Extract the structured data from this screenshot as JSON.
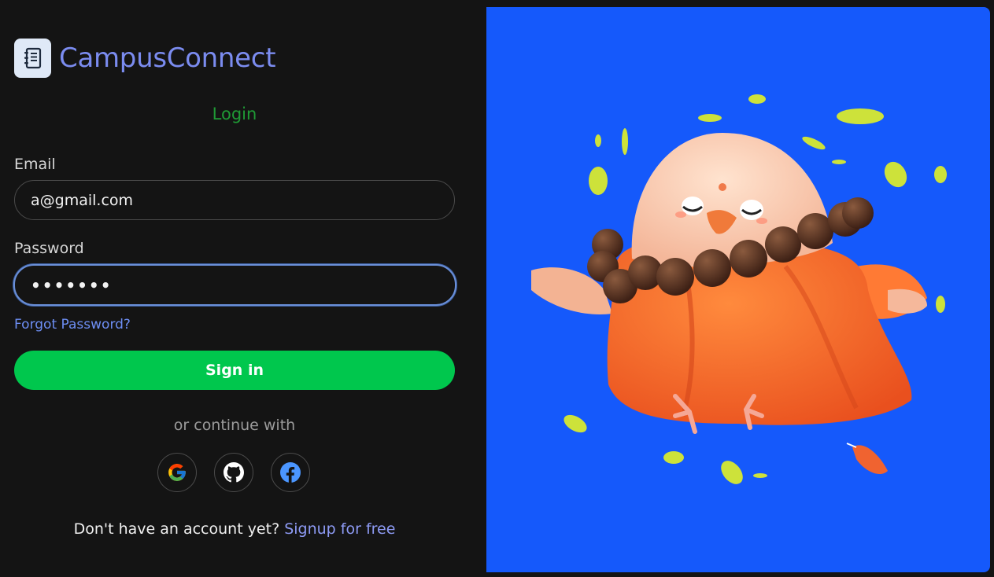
{
  "brand": {
    "name": "CampusConnect",
    "logo_icon": "notebook-icon"
  },
  "form": {
    "title": "Login",
    "email_label": "Email",
    "email_value": "a@gmail.com",
    "password_label": "Password",
    "password_value": "•••••••",
    "forgot_label": "Forgot Password?",
    "signin_label": "Sign in",
    "continue_label": "or continue with"
  },
  "social": [
    {
      "name": "google-icon"
    },
    {
      "name": "github-icon"
    },
    {
      "name": "facebook-icon"
    }
  ],
  "footer": {
    "prompt": "Don't have an account yet?",
    "signup_label": "Signup for free"
  },
  "colors": {
    "background": "#141414",
    "brand": "#7b8cf0",
    "title": "#1f9a35",
    "accent_button": "#00c74d",
    "link": "#6d8ef3",
    "illustration_bg": "#1559fb"
  },
  "illustration": {
    "subject": "bird-monk-illustration"
  }
}
